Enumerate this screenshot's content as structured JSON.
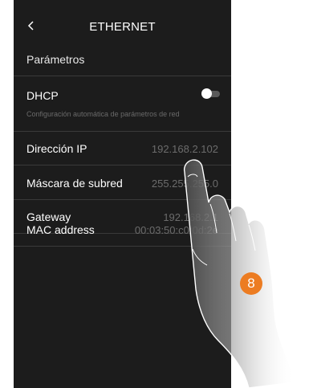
{
  "header": {
    "back_icon": "chevron-left-icon",
    "title": "ETHERNET"
  },
  "section_title": "Parámetros",
  "dhcp": {
    "label": "DHCP",
    "description": "Configuración automática de parámetros de red",
    "enabled": false
  },
  "rows": [
    {
      "label": "Dirección IP",
      "value": "192.168.2.102"
    },
    {
      "label": "Máscara de subred",
      "value": "255.255.255.0"
    },
    {
      "label": "Gateway",
      "value": "192.168.2.1"
    },
    {
      "label": "MAC address",
      "value": "00:03:50:c0:0d:2e"
    }
  ],
  "step_badge": "8",
  "colors": {
    "screen_bg": "#1c1c1c",
    "divider": "#3a3a3a",
    "muted_text": "#6c6c6c",
    "badge": "#ec7c22"
  }
}
